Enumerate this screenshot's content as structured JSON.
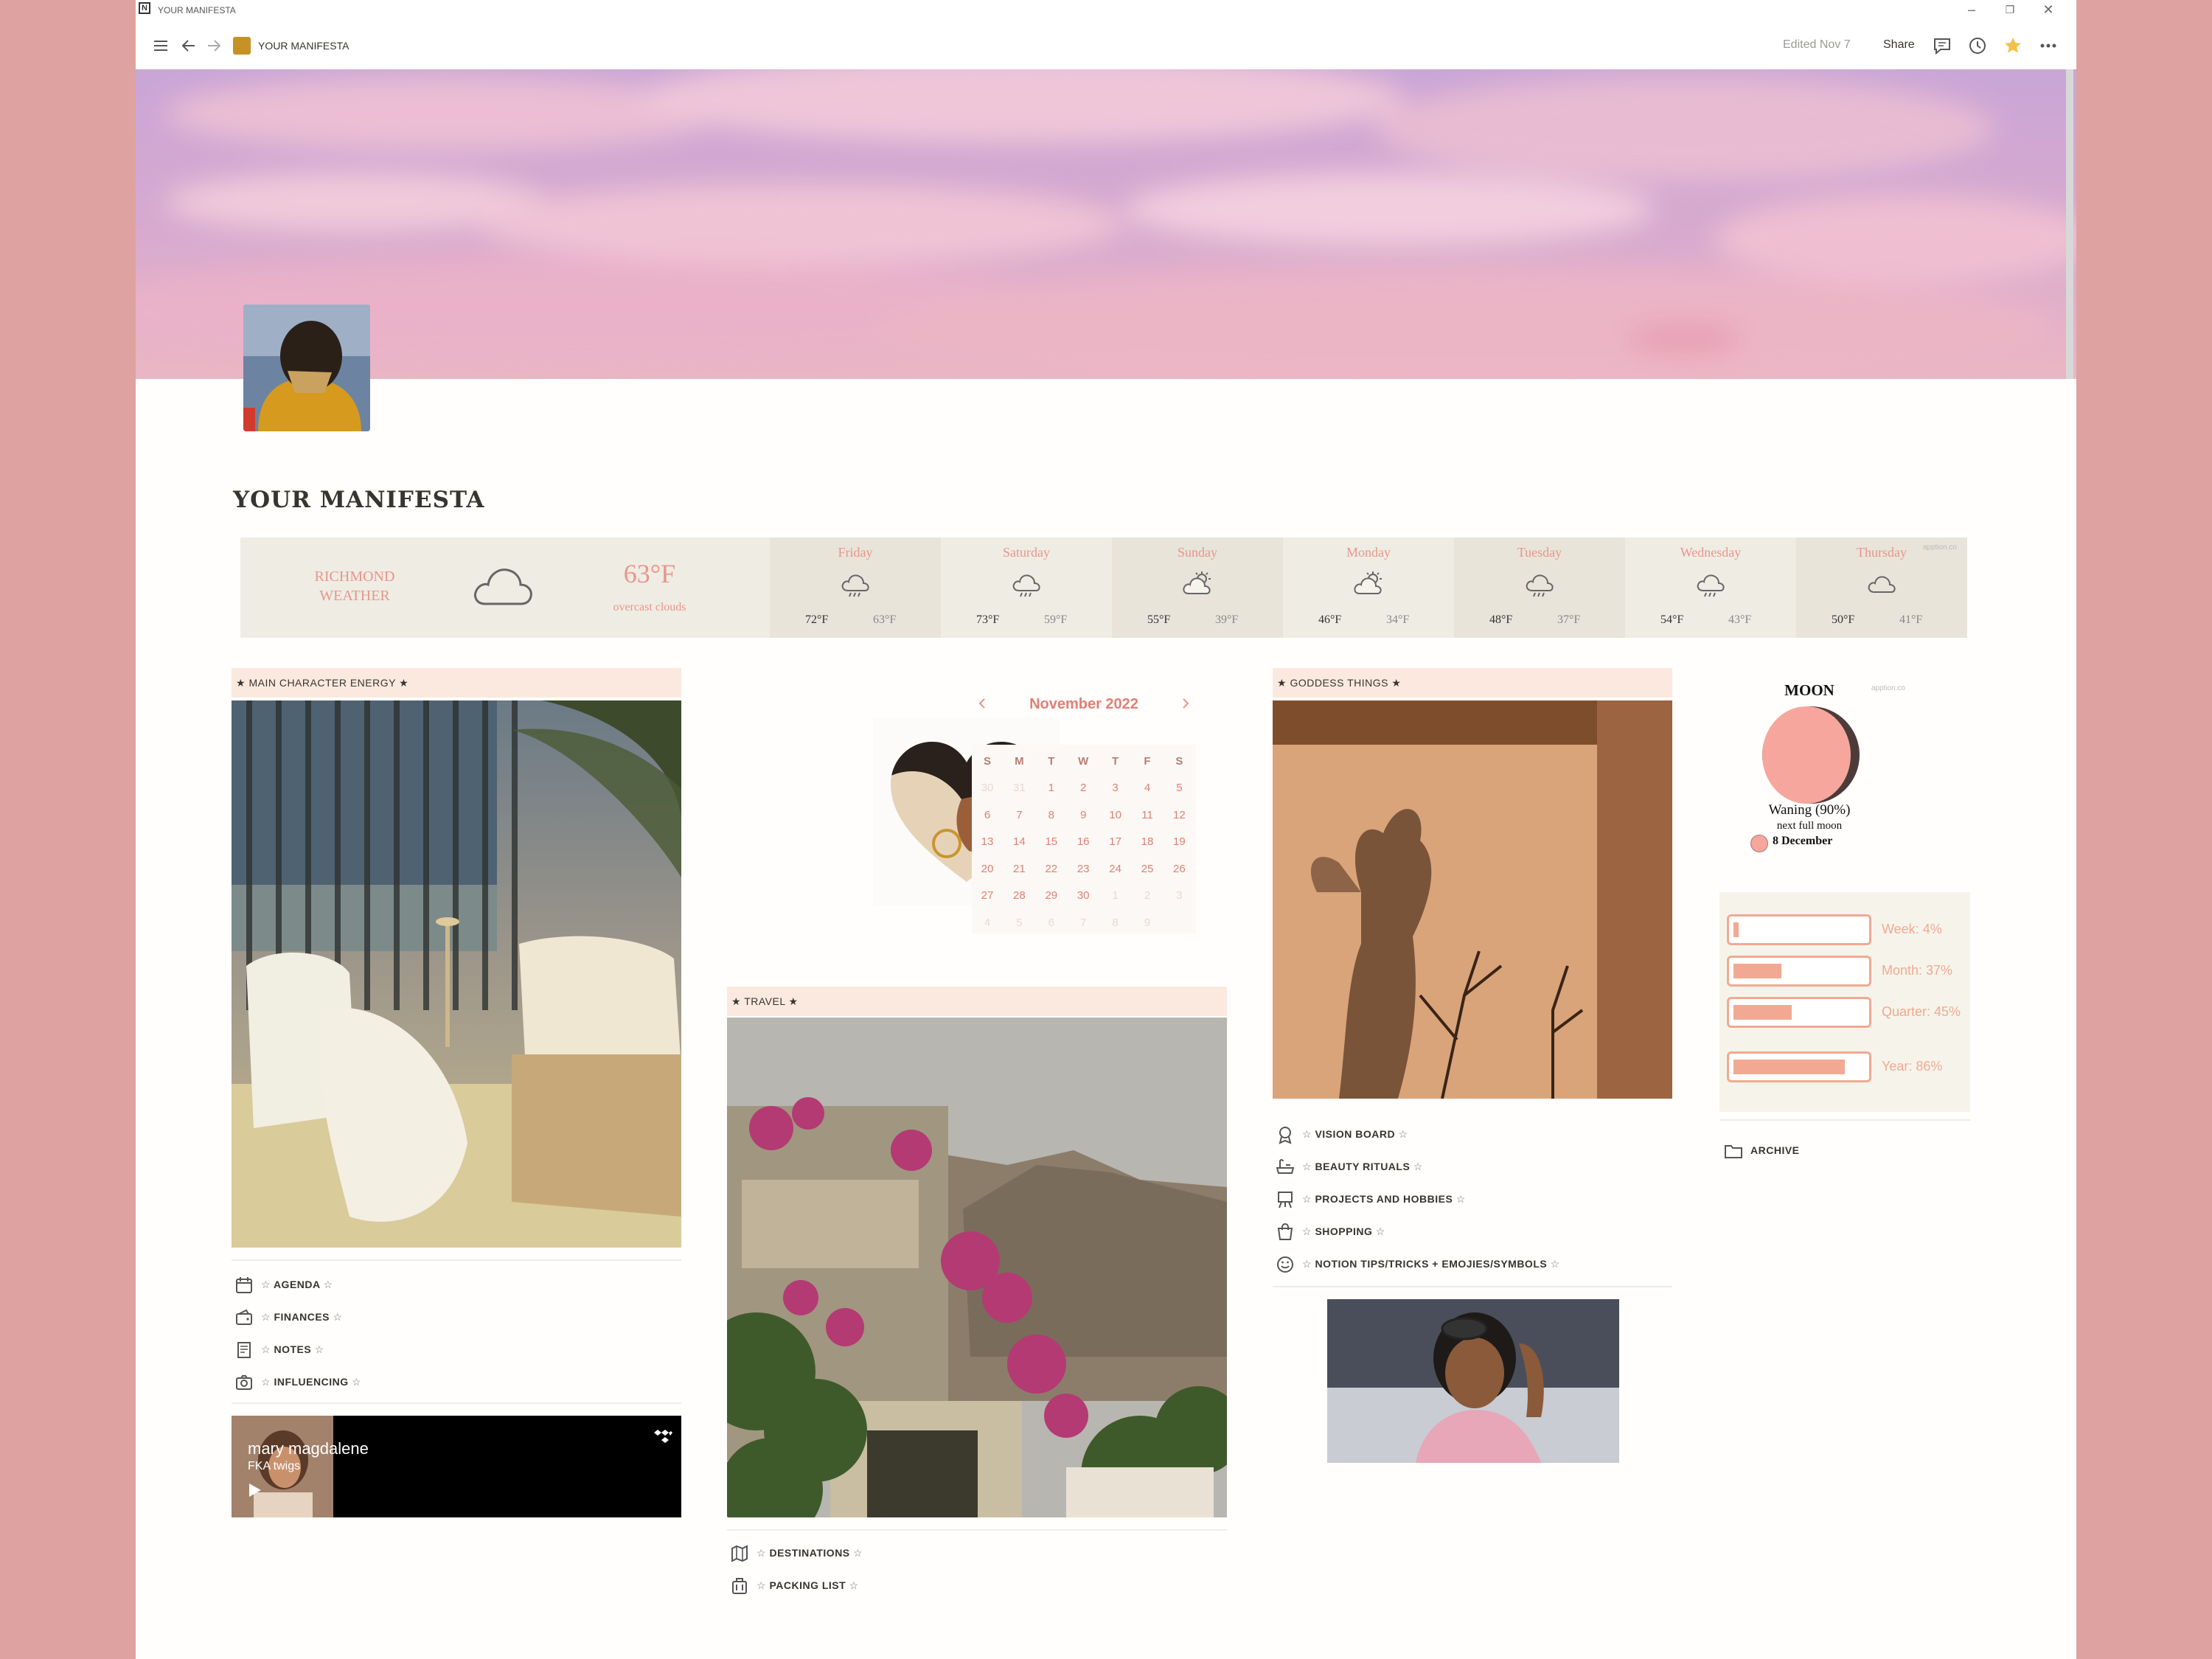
{
  "window": {
    "title": "YOUR MANIFESTA"
  },
  "topbar": {
    "breadcrumb": "YOUR MANIFESTA",
    "edited": "Edited Nov 7",
    "share": "Share"
  },
  "page": {
    "title": "YOUR MANIFESTA"
  },
  "weather": {
    "location_line1": "RICHMOND",
    "location_line2": "WEATHER",
    "current_temp": "63°F",
    "condition": "overcast clouds",
    "credit": "apption.co",
    "days": [
      {
        "name": "Friday",
        "hi": "72°F",
        "lo": "63°F",
        "icon": "rain-cloud-icon"
      },
      {
        "name": "Saturday",
        "hi": "73°F",
        "lo": "59°F",
        "icon": "rain-cloud-icon"
      },
      {
        "name": "Sunday",
        "hi": "55°F",
        "lo": "39°F",
        "icon": "partly-cloudy-icon"
      },
      {
        "name": "Monday",
        "hi": "46°F",
        "lo": "34°F",
        "icon": "partly-cloudy-icon"
      },
      {
        "name": "Tuesday",
        "hi": "48°F",
        "lo": "37°F",
        "icon": "rain-cloud-icon"
      },
      {
        "name": "Wednesday",
        "hi": "54°F",
        "lo": "43°F",
        "icon": "rain-cloud-icon"
      },
      {
        "name": "Thursday",
        "hi": "50°F",
        "lo": "41°F",
        "icon": "cloud-icon"
      }
    ]
  },
  "sections": {
    "main_character": "★ MAIN CHARACTER ENERGY ★",
    "travel": "★ TRAVEL ★",
    "goddess": "★ GODDESS THINGS ★"
  },
  "links_left": [
    {
      "label": "AGENDA",
      "icon": "calendar-icon"
    },
    {
      "label": "FINANCES",
      "icon": "wallet-icon"
    },
    {
      "label": "NOTES",
      "icon": "notes-icon"
    },
    {
      "label": "INFLUENCING",
      "icon": "camera-icon"
    }
  ],
  "links_travel": [
    {
      "label": "DESTINATIONS",
      "icon": "map-icon"
    },
    {
      "label": "PACKING LIST",
      "icon": "luggage-icon"
    }
  ],
  "links_goddess": [
    {
      "label": "VISION BOARD",
      "icon": "award-icon"
    },
    {
      "label": "BEAUTY RITUALS",
      "icon": "bath-icon"
    },
    {
      "label": "PROJECTS AND HOBBIES",
      "icon": "easel-icon"
    },
    {
      "label": "SHOPPING",
      "icon": "shopping-bag-icon"
    },
    {
      "label": "NOTION TIPS/TRICKS + EMOJIES/SYMBOLS",
      "icon": "smiley-icon"
    }
  ],
  "star_prefix": "☆",
  "calendar": {
    "month": "November 2022",
    "weekdays": [
      "S",
      "M",
      "T",
      "W",
      "T",
      "F",
      "S"
    ],
    "days": [
      "30",
      "31",
      "1",
      "2",
      "3",
      "4",
      "5",
      "6",
      "7",
      "8",
      "9",
      "10",
      "11",
      "12",
      "13",
      "14",
      "15",
      "16",
      "17",
      "18",
      "19",
      "20",
      "21",
      "22",
      "23",
      "24",
      "25",
      "26",
      "27",
      "28",
      "29",
      "30",
      "1",
      "2",
      "3",
      "4",
      "5",
      "6",
      "7",
      "8",
      "9"
    ]
  },
  "moon": {
    "title": "MOON",
    "phase": "Waning (90%)",
    "next_label": "next full moon",
    "next_date": "8 December",
    "credit": "apption.co",
    "illumination": 0.9
  },
  "progress": [
    {
      "label": "Week: 4%",
      "value": 0.04
    },
    {
      "label": "Month: 37%",
      "value": 0.37
    },
    {
      "label": "Quarter: 45%",
      "value": 0.45
    },
    {
      "label": "Year: 86%",
      "value": 0.86
    }
  ],
  "archive": "ARCHIVE",
  "music": {
    "track": "mary magdalene",
    "artist": "FKA twigs"
  },
  "colors": {
    "accent": "#e8968a",
    "section_bg": "#fbe9df",
    "progress": "#f1a993",
    "background": "#dea3a1"
  }
}
